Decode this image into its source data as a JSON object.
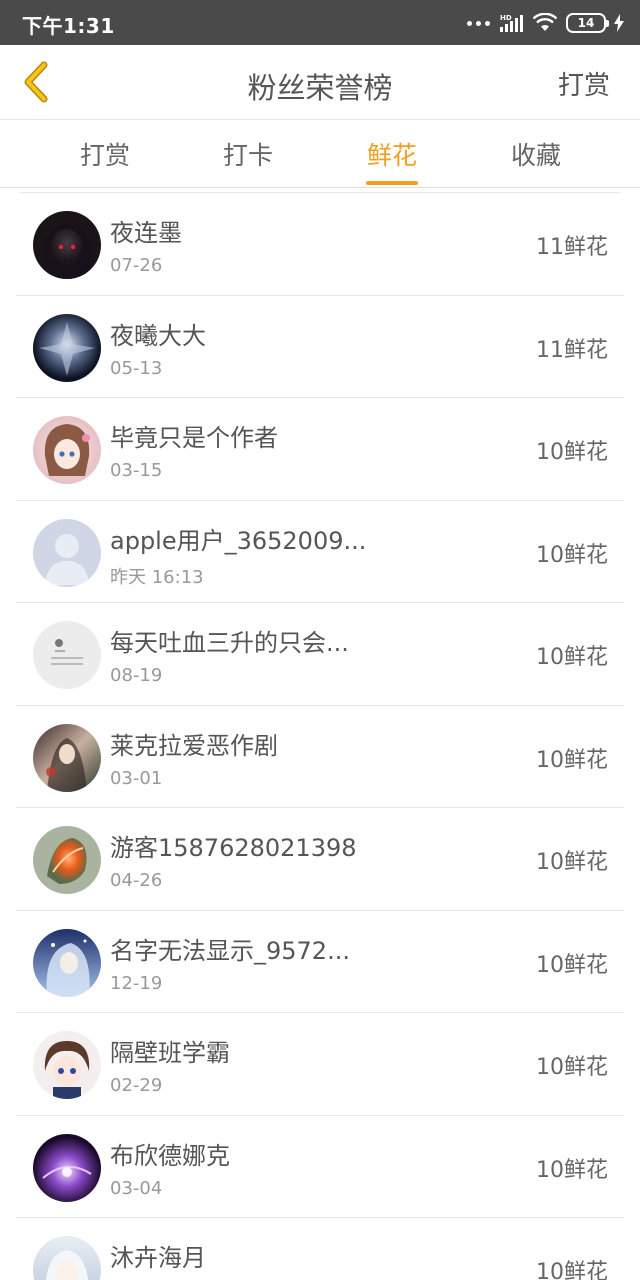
{
  "status_bar": {
    "time": "下午1:31",
    "battery": "14",
    "network_label": "HD"
  },
  "header": {
    "title": "粉丝荣誉榜",
    "action_label": "打赏",
    "accent_color": "#f0a020"
  },
  "tabs": [
    {
      "label": "打赏",
      "active": false
    },
    {
      "label": "打卡",
      "active": false
    },
    {
      "label": "鲜花",
      "active": true
    },
    {
      "label": "收藏",
      "active": false
    }
  ],
  "list": [
    {
      "name": "夜连墨",
      "date": "07-26",
      "amount": "11鲜花"
    },
    {
      "name": "夜曦大大",
      "date": "05-13",
      "amount": "11鲜花"
    },
    {
      "name": "毕竟只是个作者",
      "date": "03-15",
      "amount": "10鲜花"
    },
    {
      "name": "apple用户_3652009...",
      "date": "昨天 16:13",
      "amount": "10鲜花"
    },
    {
      "name": "每天吐血三升的只会...",
      "date": "08-19",
      "amount": "10鲜花"
    },
    {
      "name": "莱克拉爱恶作剧",
      "date": "03-01",
      "amount": "10鲜花"
    },
    {
      "name": "游客1587628021398",
      "date": "04-26",
      "amount": "10鲜花"
    },
    {
      "name": "名字无法显示_9572...",
      "date": "12-19",
      "amount": "10鲜花"
    },
    {
      "name": "隔壁班学霸",
      "date": "02-29",
      "amount": "10鲜花"
    },
    {
      "name": "布欣德娜克",
      "date": "03-04",
      "amount": "10鲜花"
    },
    {
      "name": "沐卉海月",
      "date": "",
      "amount": "10鲜花"
    }
  ]
}
